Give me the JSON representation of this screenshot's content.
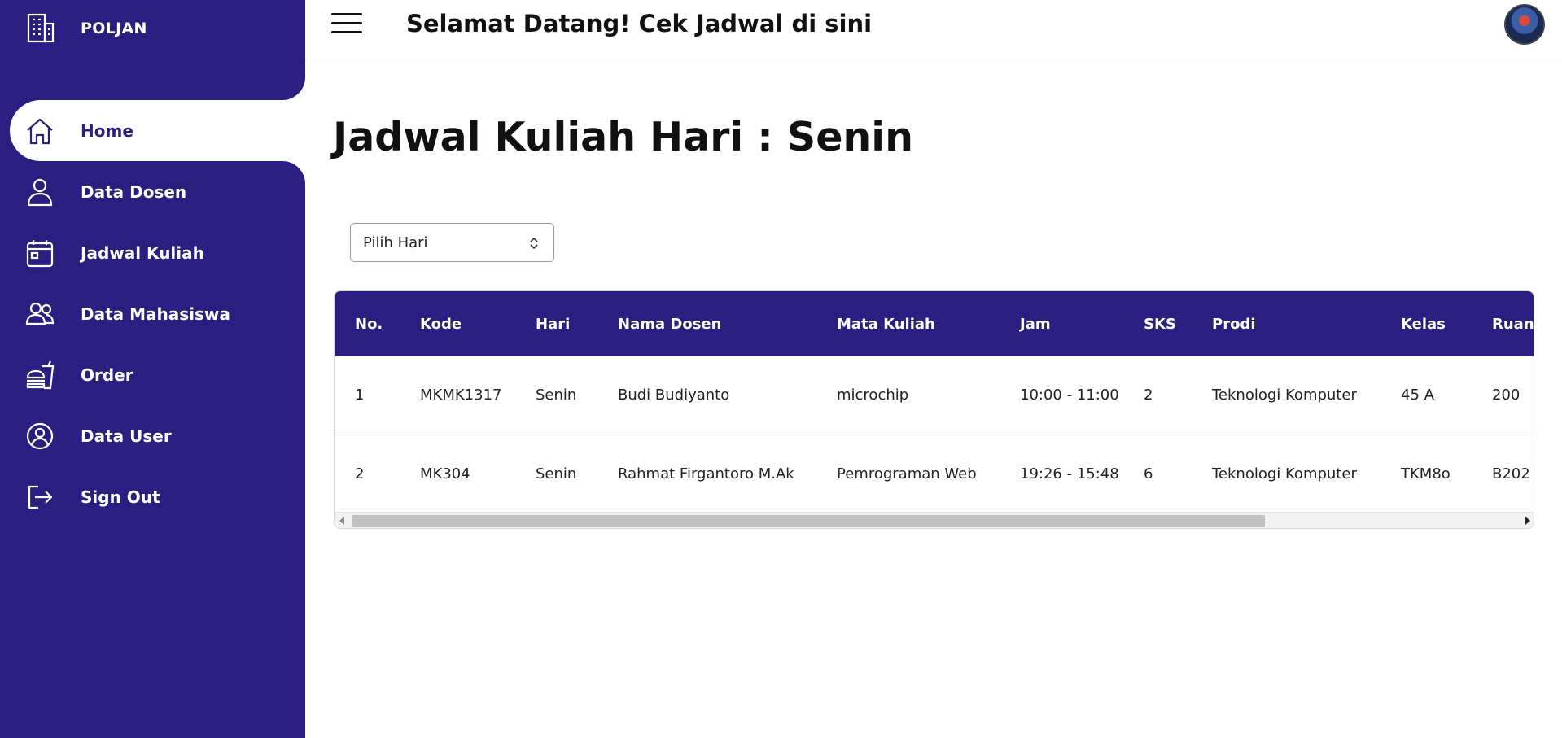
{
  "brand": {
    "label": "POLJAN",
    "icon": "building-icon"
  },
  "sidebar": {
    "items": [
      {
        "label": "Home",
        "icon": "home-icon",
        "active": true
      },
      {
        "label": "Data Dosen",
        "icon": "user-icon"
      },
      {
        "label": "Jadwal Kuliah",
        "icon": "calendar-icon"
      },
      {
        "label": "Data Mahasiswa",
        "icon": "users-icon"
      },
      {
        "label": "Order",
        "icon": "fastfood-icon"
      },
      {
        "label": "Data User",
        "icon": "user-circle-icon"
      },
      {
        "label": "Sign Out",
        "icon": "sign-out-icon"
      }
    ]
  },
  "header": {
    "title": "Selamat Datang! Cek Jadwal di sini"
  },
  "main": {
    "page_title": "Jadwal Kuliah Hari : Senin",
    "day_select": {
      "value": "Pilih Hari"
    }
  },
  "table": {
    "headers": [
      "No.",
      "Kode",
      "Hari",
      "Nama Dosen",
      "Mata Kuliah",
      "Jam",
      "SKS",
      "Prodi",
      "Kelas",
      "Ruang"
    ],
    "rows": [
      [
        "1",
        "MKMK1317",
        "Senin",
        "Budi Budiyanto",
        "microchip",
        "10:00 - 11:00",
        "2",
        "Teknologi Komputer",
        "45 A",
        "200"
      ],
      [
        "2",
        "MK304",
        "Senin",
        "Rahmat Firgantoro M.Ak",
        "Pemrograman Web",
        "19:26 - 15:48",
        "6",
        "Teknologi Komputer",
        "TKM8o",
        "B202"
      ]
    ]
  },
  "colors": {
    "primary": "#2a1f80",
    "background": "#ffffff"
  }
}
